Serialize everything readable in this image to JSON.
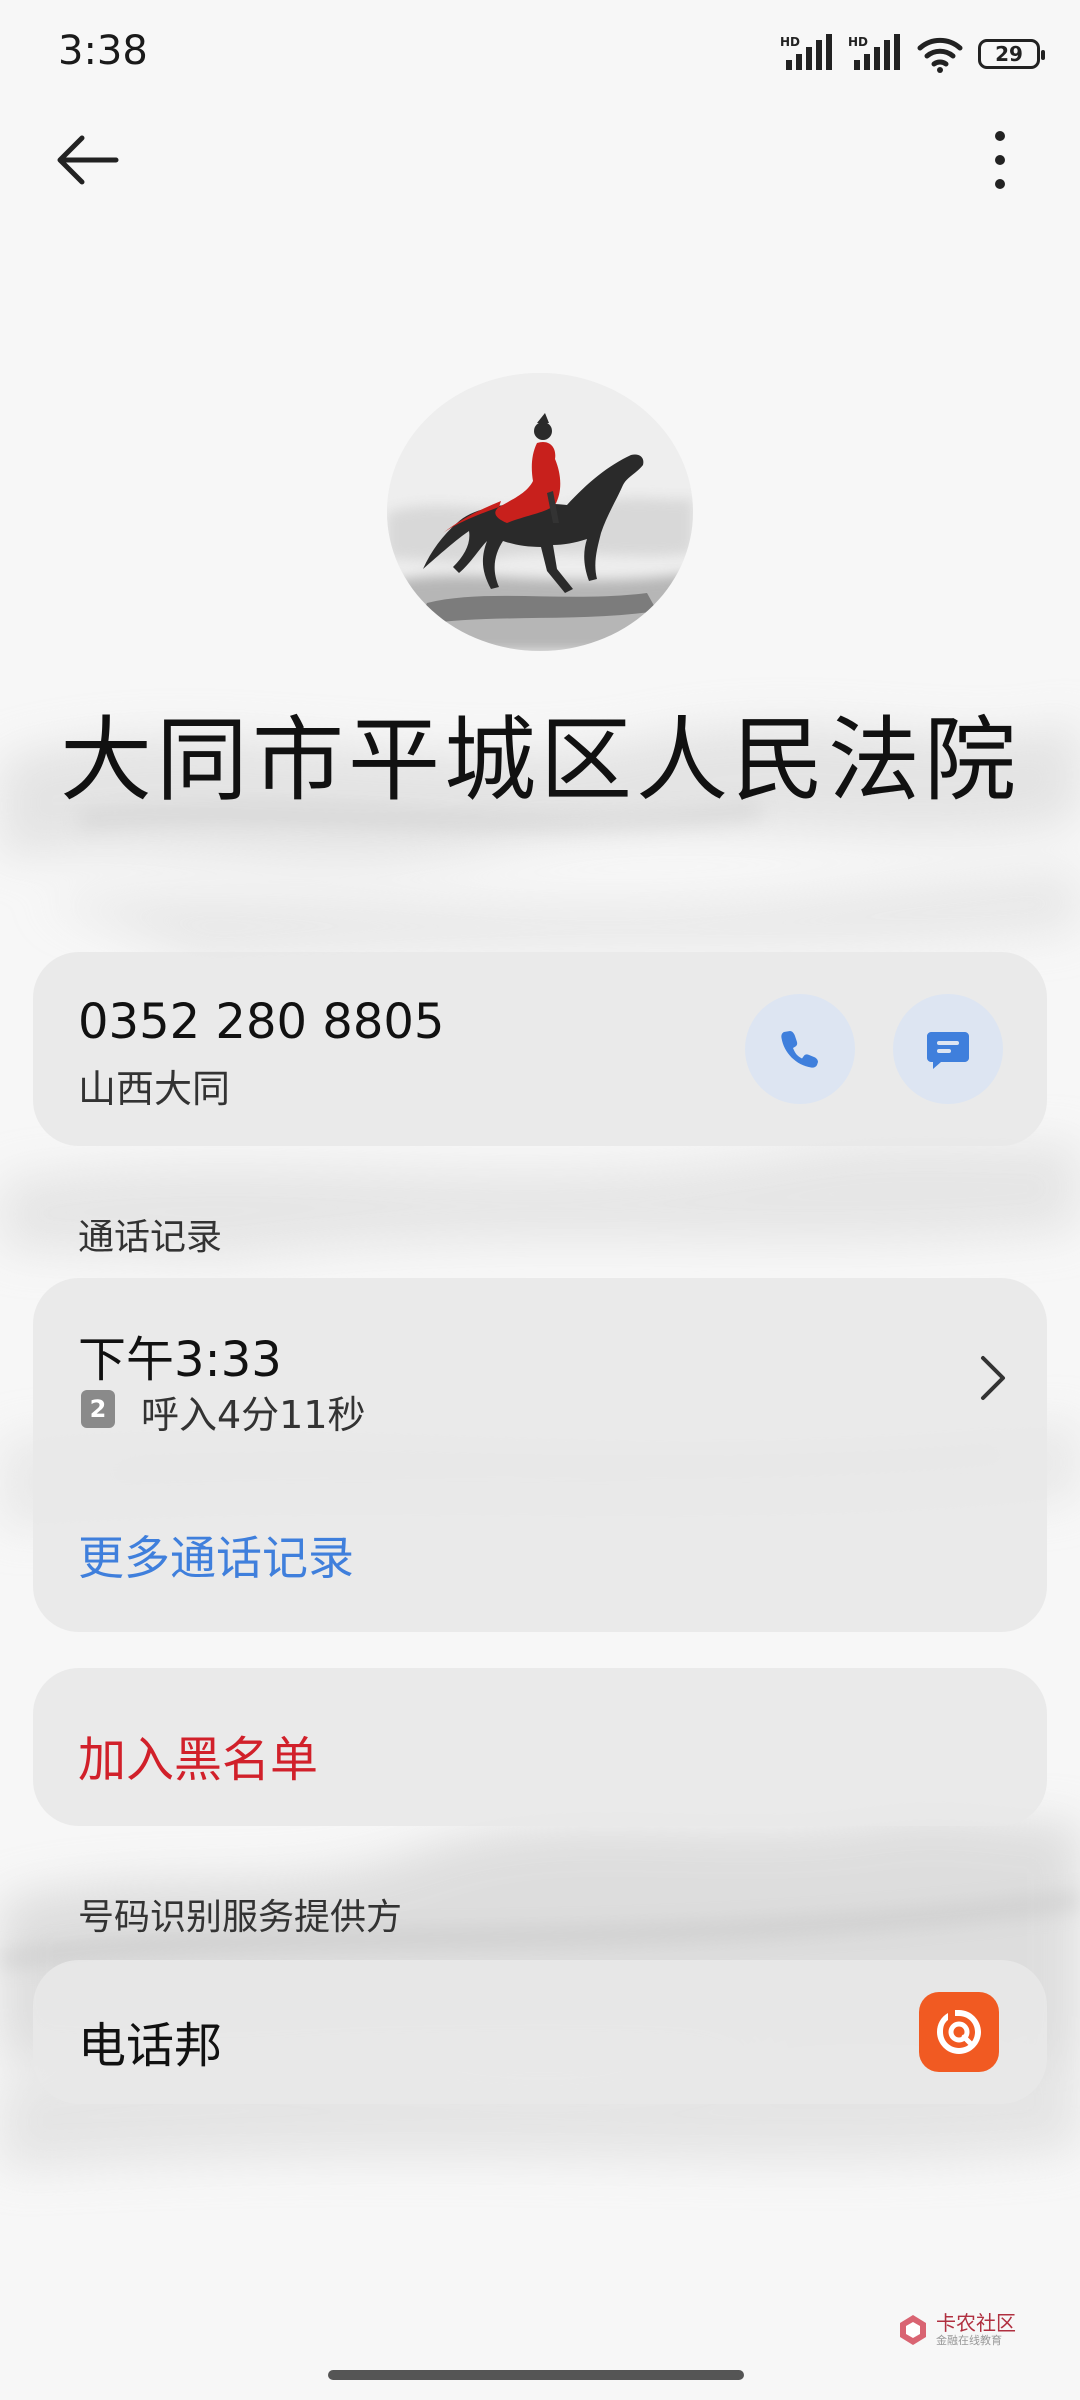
{
  "status_bar": {
    "time": "3:38",
    "battery_level": "29",
    "icons": [
      "hd-signal-icon",
      "hd-signal-icon",
      "wifi-icon",
      "battery-icon"
    ]
  },
  "nav": {
    "back_icon": "back-arrow-icon",
    "more_icon": "more-vertical-icon"
  },
  "contact": {
    "name": "大同市平城区人民法院",
    "avatar": "ink-painting-horse-rider"
  },
  "phone_card": {
    "number": "0352 280 8805",
    "location": "山西大同",
    "call_icon": "phone-icon",
    "message_icon": "message-icon",
    "accent_color": "#3f7fdc"
  },
  "call_log": {
    "section_label": "通话记录",
    "entry_time": "下午3:33",
    "sim_slot": "2",
    "entry_detail": "呼入4分11秒",
    "more_label": "更多通话记录"
  },
  "blacklist": {
    "label": "加入黑名单",
    "color": "#d1202a"
  },
  "provider": {
    "section_label": "号码识别服务提供方",
    "name": "电话邦",
    "logo_color": "#f15a22"
  },
  "watermark": {
    "text": "卡农社区",
    "subtext": "金融在线教育"
  }
}
